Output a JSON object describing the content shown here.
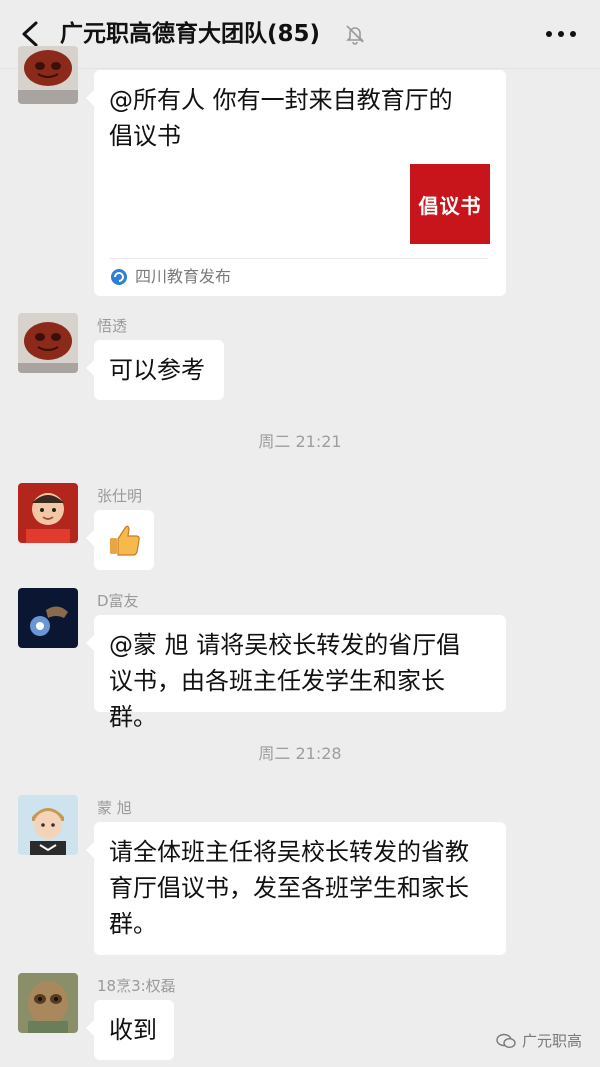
{
  "header": {
    "back_label": "<",
    "title": "广元职高德育大团队(85)",
    "more_label": "···"
  },
  "messages": [
    {
      "sender": "",
      "text_line1": "@所有人 你有一封来自教育厅的",
      "text_line2": "倡议书",
      "card_thumb_text": "倡议书",
      "card_source": "四川教育发布"
    },
    {
      "sender": "悟透",
      "text": "可以参考"
    },
    {
      "sender": "张仕明",
      "sticker": "thumbs-up"
    },
    {
      "sender": "D富友",
      "text_line1": "@蒙  旭   请将吴校长转发的省厅倡",
      "text_line2": "议书，由各班主任发学生和家长群。"
    },
    {
      "sender": "蒙  旭",
      "text_line1": "请全体班主任将吴校长转发的省教",
      "text_line2": "育厅倡议书，发至各班学生和家长",
      "text_line3": "群。"
    },
    {
      "sender": "18烹3:权磊",
      "text": "收到"
    }
  ],
  "timestamps": [
    "周二 21:21",
    "周二 21:28"
  ],
  "watermark": {
    "text": "广元职高"
  },
  "colors": {
    "background": "#ededed",
    "bubble": "#ffffff",
    "card_thumb": "#c8151b"
  }
}
